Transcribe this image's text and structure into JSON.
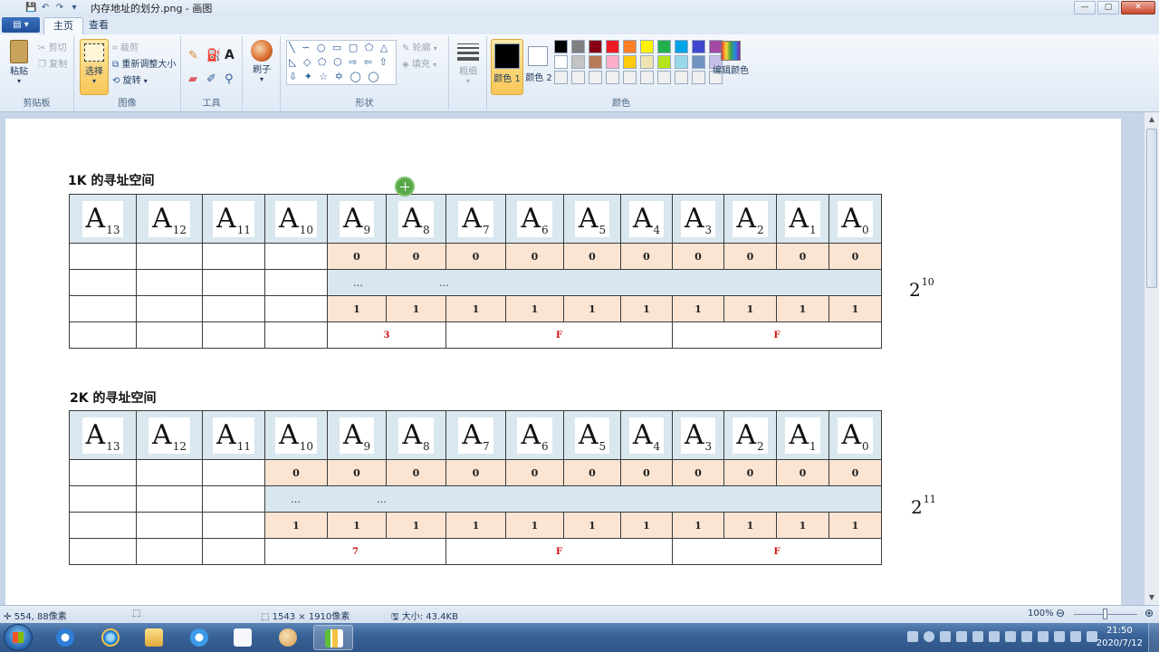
{
  "window": {
    "title": "内存地址的划分.png - 画图",
    "controls": {
      "minimize": "—",
      "maximize": "▢",
      "close": "✕"
    }
  },
  "quick_access": {
    "save": "💾",
    "undo": "↶",
    "redo": "↷",
    "customize": "▾"
  },
  "tabs": {
    "file_menu": "▤ ▾",
    "home": "主页",
    "view": "查看"
  },
  "ribbon": {
    "clipboard": {
      "paste": "粘贴",
      "cut": "剪切",
      "copy": "复制",
      "label": "剪贴板"
    },
    "image": {
      "select": "选择",
      "crop": "裁剪",
      "resize": "重新调整大小",
      "rotate": "旋转",
      "label": "图像"
    },
    "tools": {
      "label": "工具"
    },
    "brushes": {
      "label": "刷子"
    },
    "shapes": {
      "outline": "轮廓",
      "fill": "填充",
      "label": "形状",
      "glyphs": "╲ ∽ ○ ▭ ▢ ⬠ △ ◺ ◇ ⬠ ⬡ ⇨ ⇦ ⇧ ⇩ ✦ ☆ ✡ ◯ ◯ ☐"
    },
    "size": {
      "label": "粗细"
    },
    "colors": {
      "color1": "颜色 1",
      "color2": "颜色 2",
      "edit_colors": "编辑颜色",
      "label": "颜色",
      "color1_value": "#000000",
      "color2_value": "#ffffff",
      "palette": [
        "#000000",
        "#7f7f7f",
        "#880015",
        "#ed1c24",
        "#ff7f27",
        "#fff200",
        "#22b14c",
        "#00a2e8",
        "#3f48cc",
        "#a349a4",
        "#ffffff",
        "#c3c3c3",
        "#b97a57",
        "#ffaec9",
        "#ffc90e",
        "#efe4b0",
        "#b5e61d",
        "#99d9ea",
        "#7092be",
        "#c8bfe7",
        "#f0f0f0",
        "#f0f0f0",
        "#f0f0f0",
        "#f0f0f0",
        "#f0f0f0",
        "#f0f0f0",
        "#f0f0f0",
        "#f0f0f0",
        "#f0f0f0",
        "#f0f0f0"
      ]
    }
  },
  "canvas": {
    "section1": {
      "title": "1K  的寻址空间",
      "headers": [
        {
          "letter": "A",
          "sub": "13"
        },
        {
          "letter": "A",
          "sub": "12"
        },
        {
          "letter": "A",
          "sub": "11"
        },
        {
          "letter": "A",
          "sub": "10"
        },
        {
          "letter": "A",
          "sub": "9"
        },
        {
          "letter": "A",
          "sub": "8"
        },
        {
          "letter": "A",
          "sub": "7"
        },
        {
          "letter": "A",
          "sub": "6"
        },
        {
          "letter": "A",
          "sub": "5"
        },
        {
          "letter": "A",
          "sub": "4"
        },
        {
          "letter": "A",
          "sub": "3"
        },
        {
          "letter": "A",
          "sub": "2"
        },
        {
          "letter": "A",
          "sub": "1"
        },
        {
          "letter": "A",
          "sub": "0"
        }
      ],
      "zeros": [
        "0",
        "0",
        "0",
        "0",
        "0",
        "0",
        "0",
        "0",
        "0",
        "0"
      ],
      "dots": [
        "…",
        "…"
      ],
      "ones": [
        "1",
        "1",
        "1",
        "1",
        "1",
        "1",
        "1",
        "1",
        "1",
        "1"
      ],
      "hex": [
        "3",
        "F",
        "F"
      ],
      "power": {
        "base": "2",
        "exp": "10"
      }
    },
    "section2": {
      "title": "2K  的寻址空间",
      "headers": [
        {
          "letter": "A",
          "sub": "13"
        },
        {
          "letter": "A",
          "sub": "12"
        },
        {
          "letter": "A",
          "sub": "11"
        },
        {
          "letter": "A",
          "sub": "10"
        },
        {
          "letter": "A",
          "sub": "9"
        },
        {
          "letter": "A",
          "sub": "8"
        },
        {
          "letter": "A",
          "sub": "7"
        },
        {
          "letter": "A",
          "sub": "6"
        },
        {
          "letter": "A",
          "sub": "5"
        },
        {
          "letter": "A",
          "sub": "4"
        },
        {
          "letter": "A",
          "sub": "3"
        },
        {
          "letter": "A",
          "sub": "2"
        },
        {
          "letter": "A",
          "sub": "1"
        },
        {
          "letter": "A",
          "sub": "0"
        }
      ],
      "zeros": [
        "0",
        "0",
        "0",
        "0",
        "0",
        "0",
        "0",
        "0",
        "0",
        "0",
        "0"
      ],
      "dots": [
        "…",
        "…"
      ],
      "ones": [
        "1",
        "1",
        "1",
        "1",
        "1",
        "1",
        "1",
        "1",
        "1",
        "1",
        "1"
      ],
      "hex": [
        "7",
        "F",
        "F"
      ],
      "power": {
        "base": "2",
        "exp": "11"
      }
    }
  },
  "statusbar": {
    "cursor_pos": "554, 88像素",
    "image_size": "1543 × 1910像素",
    "file_size": "大小: 43.4KB",
    "zoom": "100%",
    "zoom_out": "⊖",
    "zoom_in": "⊕"
  },
  "taskbar": {
    "clock_time": "21:50",
    "clock_date": "2020/7/12",
    "apps": [
      "baidu-netdisk",
      "internet-explorer",
      "file-explorer",
      "baidu-netdisk-2",
      "notepad",
      "paint",
      "charts-app"
    ]
  }
}
